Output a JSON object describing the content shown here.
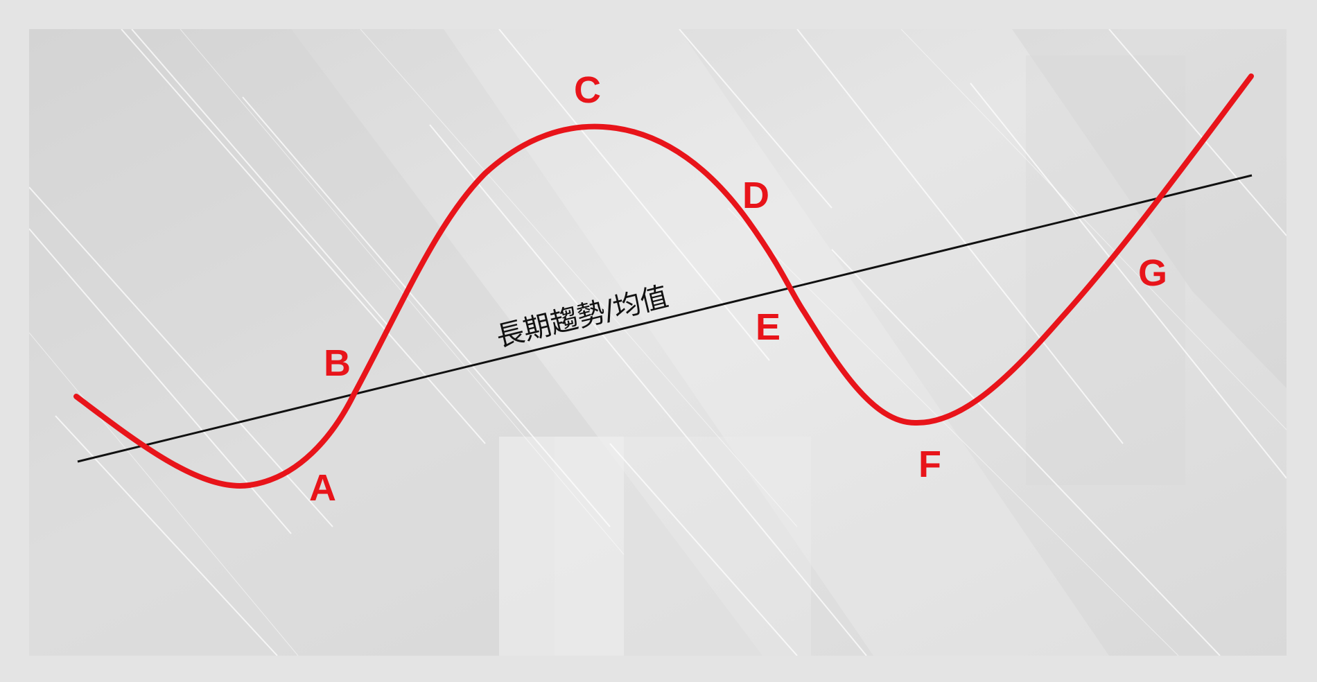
{
  "diagram": {
    "trend_label": "長期趨勢/均值",
    "points": [
      {
        "id": "A",
        "label": "A"
      },
      {
        "id": "B",
        "label": "B"
      },
      {
        "id": "C",
        "label": "C"
      },
      {
        "id": "D",
        "label": "D"
      },
      {
        "id": "E",
        "label": "E"
      },
      {
        "id": "F",
        "label": "F"
      },
      {
        "id": "G",
        "label": "G"
      }
    ],
    "colors": {
      "wave": "#e8141a",
      "trend_line": "#111111",
      "label": "#e8141a",
      "trend_text": "#111111",
      "background": "#e4e4e4",
      "panel": "#dcdcdc",
      "streak": "#ffffff"
    }
  }
}
